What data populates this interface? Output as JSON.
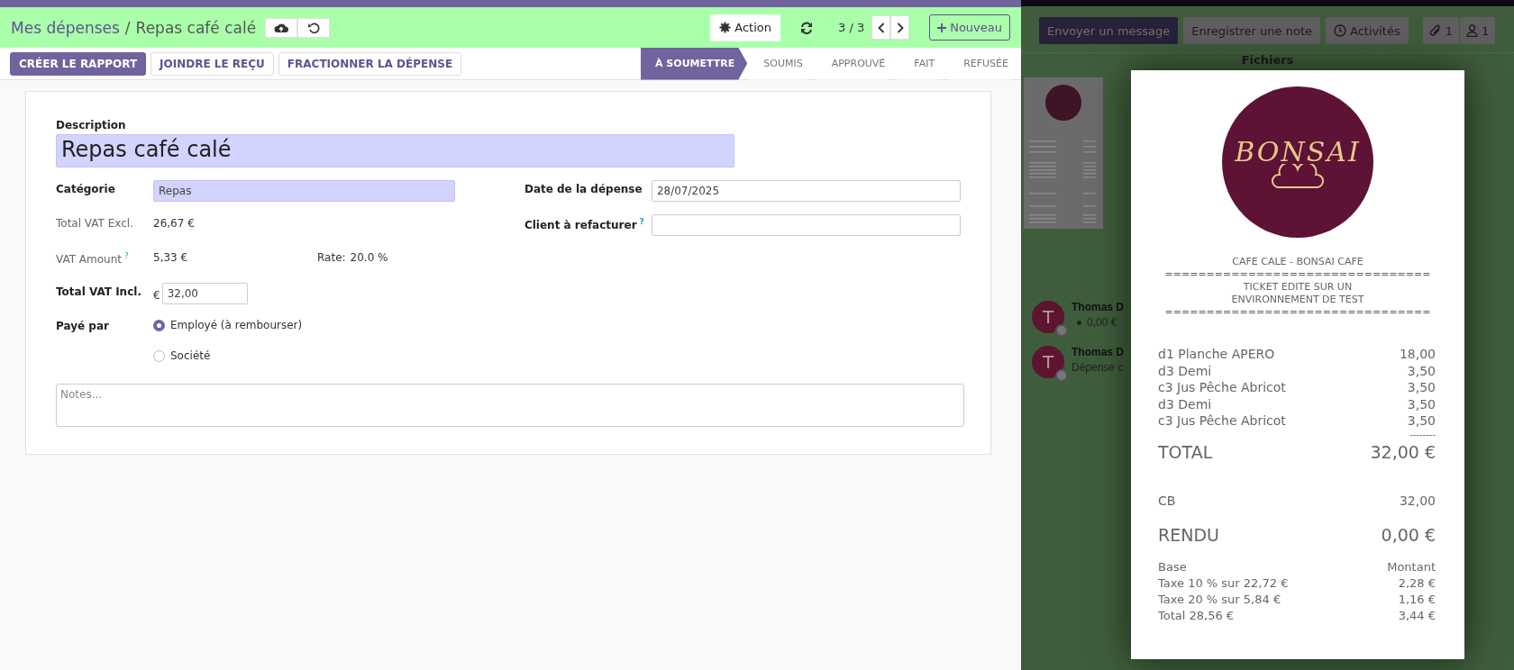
{
  "breadcrumb": {
    "parent": "Mes dépenses",
    "separator": "/",
    "current": "Repas café calé"
  },
  "control_panel": {
    "action": "Action",
    "pager": "3 / 3",
    "new_button": "Nouveau"
  },
  "buttons": [
    {
      "label": "CRÉER LE RAPPORT",
      "primary": true
    },
    {
      "label": "JOINDRE LE REÇU",
      "primary": false
    },
    {
      "label": "FRACTIONNER LA DÉPENSE",
      "primary": false
    }
  ],
  "stages": [
    {
      "label": "À SOUMETTRE",
      "selected": true
    },
    {
      "label": "SOUMIS",
      "selected": false
    },
    {
      "label": "APPROUVÉ",
      "selected": false
    },
    {
      "label": "FAIT",
      "selected": false
    },
    {
      "label": "REFUSÉE",
      "selected": false
    }
  ],
  "form": {
    "description": {
      "label": "Description",
      "value": "Repas café calé"
    },
    "left": [
      {
        "kind": "input",
        "label": "Catégorie",
        "value": "Repas",
        "highlight": true
      },
      {
        "kind": "readonly",
        "label": "Total VAT Excl.",
        "value": "26,67 €"
      },
      {
        "kind": "readonly",
        "label": "VAT Amount",
        "help": "?",
        "value": "5,33 €",
        "extra_label": "Rate:",
        "extra_value": "20.0 %"
      },
      {
        "kind": "money",
        "label": "Total VAT Incl.",
        "currency": "€",
        "value": "32,00"
      },
      {
        "kind": "radio",
        "label": "Payé par",
        "options": [
          {
            "label": "Employé (à rembourser)",
            "selected": true
          },
          {
            "label": "Société",
            "selected": false
          }
        ]
      }
    ],
    "right": [
      {
        "kind": "input",
        "label": "Date de la dépense",
        "value": "28/07/2025",
        "highlight": false
      },
      {
        "kind": "input",
        "label": "Client à refacturer",
        "help": "?",
        "highlight": false
      }
    ],
    "notes": {
      "placeholder": "Notes..."
    }
  },
  "chatter": {
    "buttons": [
      {
        "label": "Envoyer un message",
        "primary": true
      },
      {
        "label": "Enregistrer une note",
        "primary": false
      }
    ],
    "activities": "Activités",
    "attachments": "1",
    "followers": "1",
    "files_title": "Fichiers",
    "messages": [
      {
        "avatar": "T",
        "author": "Thomas D",
        "body": "0,00 €",
        "bullet": true
      },
      {
        "avatar": "T",
        "author": "Thomas D",
        "body": "Dépense c",
        "bullet": false
      }
    ]
  },
  "receipt": {
    "logo_text": "BONSAI",
    "header": [
      "CAFE CALE - BONSAI CAFE",
      "================================",
      "TICKET EDITE SUR UN",
      "ENVIRONNEMENT DE TEST",
      "================================"
    ],
    "lines": [
      {
        "name": "d1 Planche APERO",
        "amount": "18,00"
      },
      {
        "name": "d3 Demi",
        "amount": "3,50"
      },
      {
        "name": "c3 Jus Pêche Abricot",
        "amount": "3,50"
      },
      {
        "name": "d3 Demi",
        "amount": "3,50"
      },
      {
        "name": "c3 Jus Pêche Abricot",
        "amount": "3,50"
      }
    ],
    "separator": "--------",
    "total": {
      "label": "TOTAL",
      "amount": "32,00 €"
    },
    "payment": {
      "label": "CB",
      "amount": "32,00"
    },
    "change": {
      "label": "RENDU",
      "amount": "0,00 €"
    },
    "taxes": [
      {
        "name": "Base",
        "amount": "Montant"
      },
      {
        "name": "Taxe 10 % sur 22,72 €",
        "amount": "2,28 €"
      },
      {
        "name": "Taxe 20 % sur 5,84 €",
        "amount": "1,16 €"
      },
      {
        "name": "Total 28,56 €",
        "amount": "3,44 €"
      }
    ]
  }
}
